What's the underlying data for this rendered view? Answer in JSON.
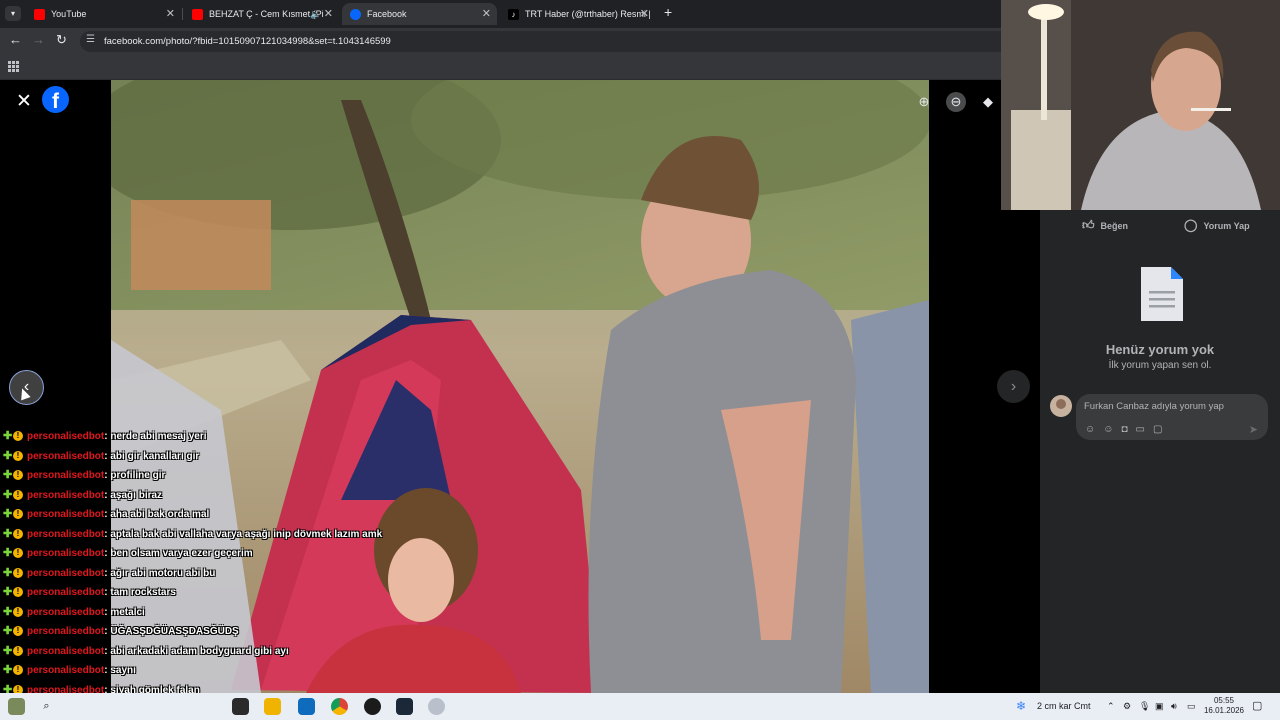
{
  "browser": {
    "tabs": [
      {
        "title": "YouTube",
        "icon": "youtube-icon",
        "icon_color": "#ff0000"
      },
      {
        "title": "BEHZAT Ç - Cem Kısmet (Pi",
        "icon": "youtube-icon",
        "icon_color": "#ff0000"
      },
      {
        "title": "Facebook",
        "icon": "facebook-icon",
        "icon_color": "#0866ff"
      },
      {
        "title": "TRT Haber (@trthaber) Resmi |",
        "icon": "tiktok-icon",
        "icon_color": "#000000"
      }
    ],
    "url": "facebook.com/photo/?fbid=10150907121034998&set=t.1043146599"
  },
  "viewer": {
    "close_icon": "close-icon",
    "zoom_in_icon": "zoom-in-icon",
    "zoom_out_icon": "zoom-out-icon",
    "tag_icon": "tag-icon",
    "prev_icon": "chevron-left-icon",
    "next_icon": "chevron-right-icon"
  },
  "chat": [
    {
      "user": "personalisedbot",
      "text": ": nerde abi mesaj yeri"
    },
    {
      "user": "personalisedbot",
      "text": ": abi gir kanalları gir"
    },
    {
      "user": "personalisedbot",
      "text": ": profiline gir"
    },
    {
      "user": "personalisedbot",
      "text": ": aşağı biraz"
    },
    {
      "user": "personalisedbot",
      "text": ": aha abi bak orda mal"
    },
    {
      "user": "personalisedbot",
      "text": ": aptala bak abi vallaha varya aşağı inip dövmek lazım amk"
    },
    {
      "user": "personalisedbot",
      "text": ": ben olsam varya ezer geçerim"
    },
    {
      "user": "personalisedbot",
      "text": ": ağır abi motoru abi bu"
    },
    {
      "user": "personalisedbot",
      "text": ": tam rockstars"
    },
    {
      "user": "personalisedbot",
      "text": ": metalci"
    },
    {
      "user": "personalisedbot",
      "text": ": ÜĞASŞDĞÜASŞDASĞÜDŞ"
    },
    {
      "user": "personalisedbot",
      "text": ": abi arkadaki adam bodyguard gibi ayı"
    },
    {
      "user": "personalisedbot",
      "text": ": saynı"
    },
    {
      "user": "personalisedbot",
      "text": ": siyah gömlek falan"
    },
    {
      "user": "personalisedbot",
      "text": ": bu kızıl saçlı kız eski sevgilin mi abi"
    }
  ],
  "comments": {
    "like_label": "Beğen",
    "comment_label": "Yorum Yap",
    "empty_title": "Henüz yorum yok",
    "empty_subtitle": "İlk yorum yapan sen ol.",
    "input_placeholder": "Furkan Canbaz adıyla yorum yap"
  },
  "taskbar": {
    "weather": "2 cm kar Cmt",
    "time": "05:55",
    "date": "16.01.2026"
  },
  "colors": {
    "chat_user": "#e1171e",
    "fb_blue": "#0866ff",
    "panel_bg": "#242526"
  }
}
